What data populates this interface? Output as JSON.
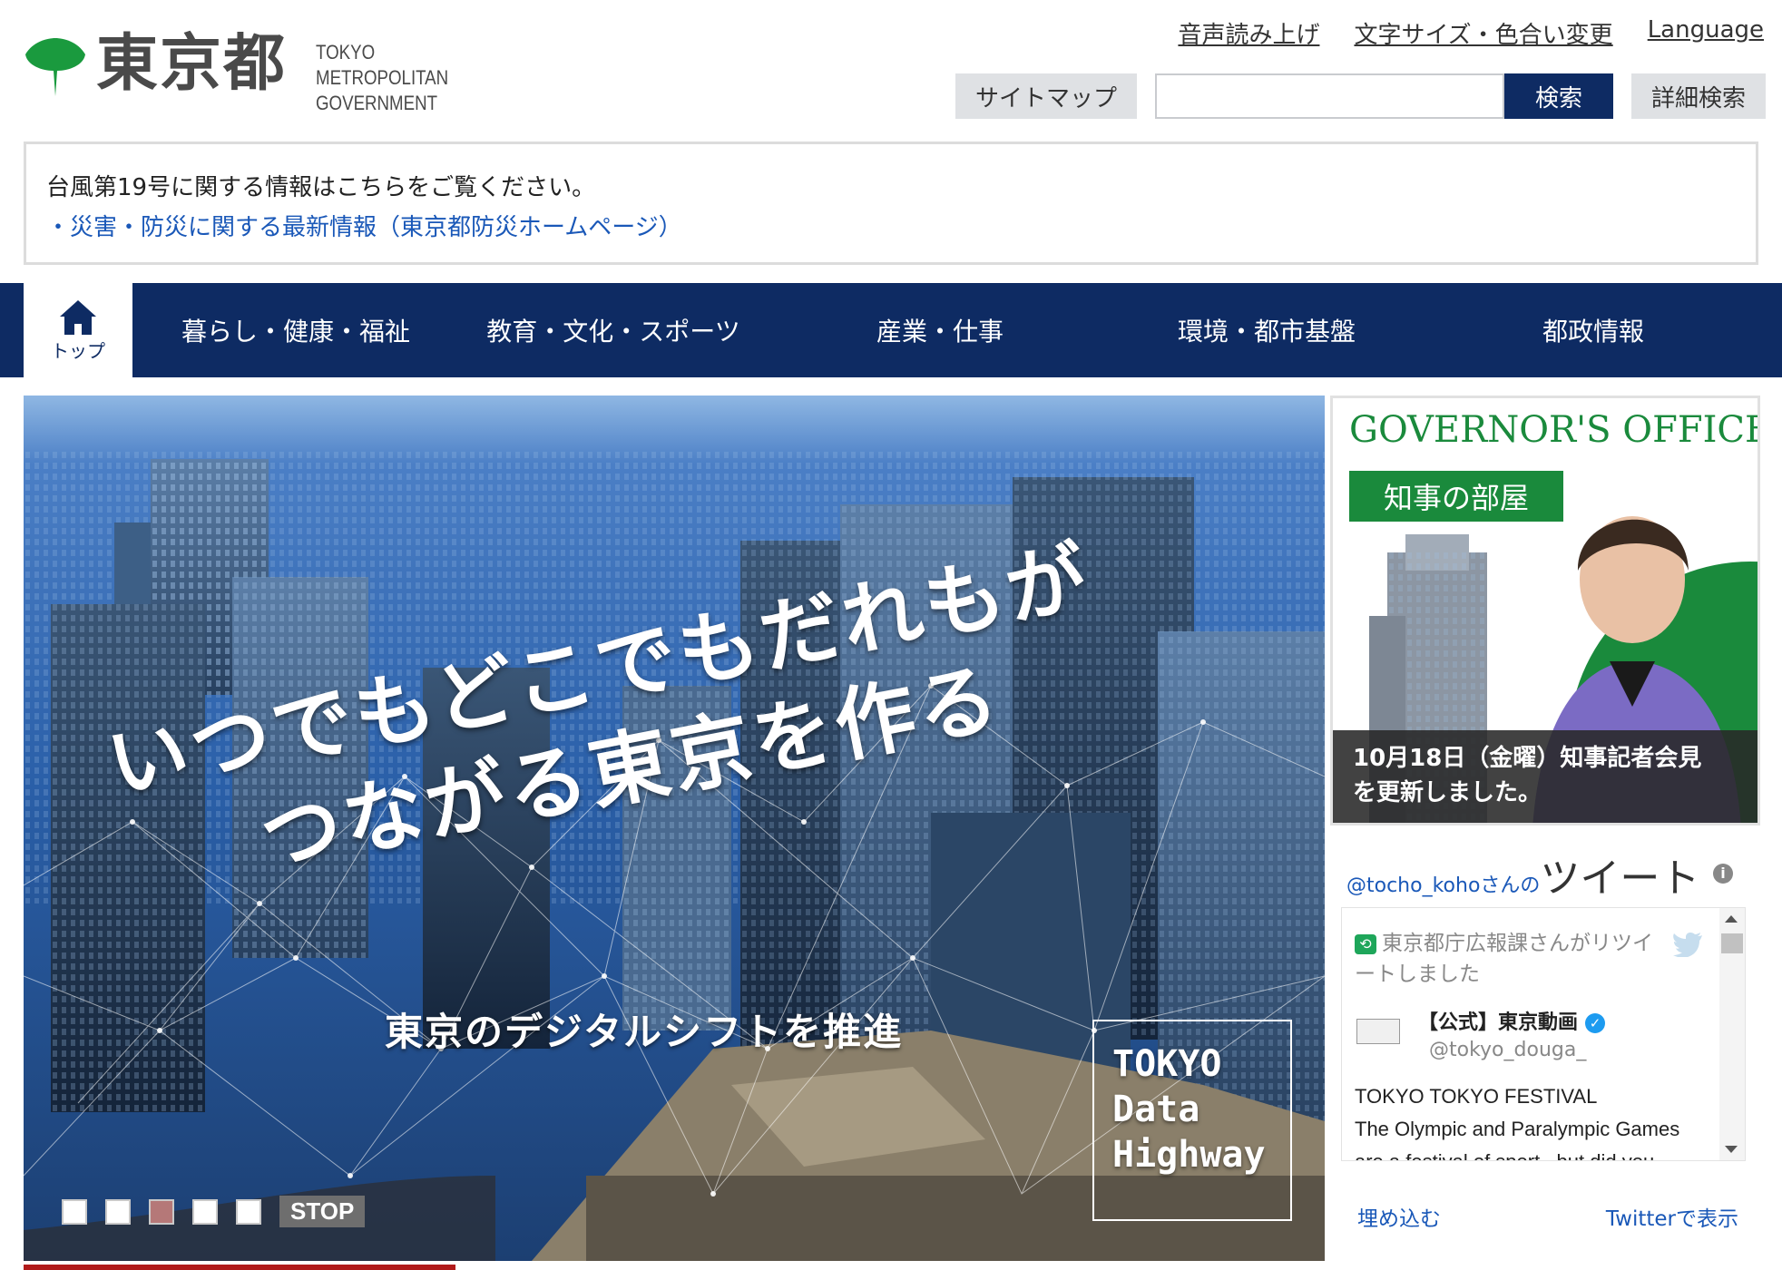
{
  "header": {
    "logo_kanji": "東京都",
    "logo_en_line1": "TOKYO METROPOLITAN",
    "logo_en_line2": "GOVERNMENT",
    "util_links": [
      "音声読み上げ",
      "文字サイズ・色合い変更",
      "Language"
    ],
    "sitemap_label": "サイトマップ",
    "search_value": "",
    "search_button": "検索",
    "advanced_search_button": "詳細検索"
  },
  "notice": {
    "text": "台風第19号に関する情報はこちらをご覧ください。",
    "link": "・災害・防災に関する最新情報（東京都防災ホームページ）"
  },
  "nav": {
    "home_label": "トップ",
    "items": [
      "暮らし・健康・福祉",
      "教育・文化・スポーツ",
      "産業・仕事",
      "環境・都市基盤",
      "都政情報"
    ]
  },
  "hero": {
    "headline_line1": "いつでもどこでもだれもが",
    "headline_line2": "つながる東京を作る",
    "subline": "東京のデジタルシフトを推進",
    "badge": [
      "TOKYO",
      "Data",
      "Highway"
    ],
    "slides_count": 5,
    "active_slide": 3,
    "stop_label": "STOP"
  },
  "governor": {
    "title": "GOVERNOR'S OFFICE",
    "tag": "知事の部屋",
    "caption_line1": "10月18日（金曜）知事記者会見",
    "caption_line2": "を更新しました。"
  },
  "twitter": {
    "handle": "@tocho_koho",
    "handle_suffix": "さんの",
    "heading": "ツイート",
    "retweet_line1": "東京都庁広報課さんがリツイ",
    "retweet_line2": "ートしました",
    "account_name": "【公式】東京動画",
    "account_handle": "@tokyo_douga_",
    "tweet_line1": "TOKYO TOKYO FESTIVAL",
    "tweet_line2": "The Olympic and Paralympic Games",
    "tweet_line3": "are a festival of sport –but did you",
    "embed_label": "埋め込む",
    "view_label": "Twitterで表示"
  },
  "colors": {
    "navy": "#0e2b63",
    "green": "#1a8a3c",
    "link_blue": "#1a58b8"
  }
}
